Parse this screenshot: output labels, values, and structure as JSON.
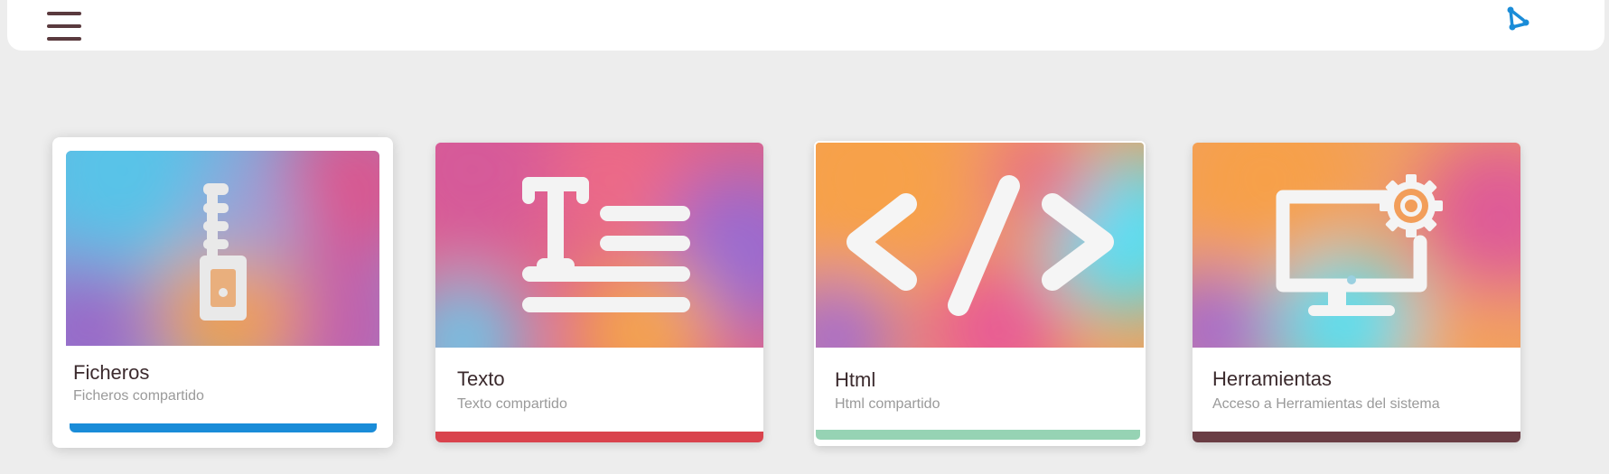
{
  "header": {
    "menu_icon": "hamburger-menu-icon",
    "share_icon": "share-icon",
    "share_color": "#1a8cd8"
  },
  "cards": [
    {
      "title": "Ficheros",
      "subtitle": "Ficheros compartido",
      "icon": "zip-file-icon",
      "accent": "#1a8cd8"
    },
    {
      "title": "Texto",
      "subtitle": "Texto compartido",
      "icon": "text-format-icon",
      "accent": "#d9434d"
    },
    {
      "title": "Html",
      "subtitle": "Html compartido",
      "icon": "code-icon",
      "accent": "#96d3b4"
    },
    {
      "title": "Herramientas",
      "subtitle": "Acceso a Herramientas del sistema",
      "icon": "computer-settings-icon",
      "accent": "#6a3d44"
    }
  ]
}
